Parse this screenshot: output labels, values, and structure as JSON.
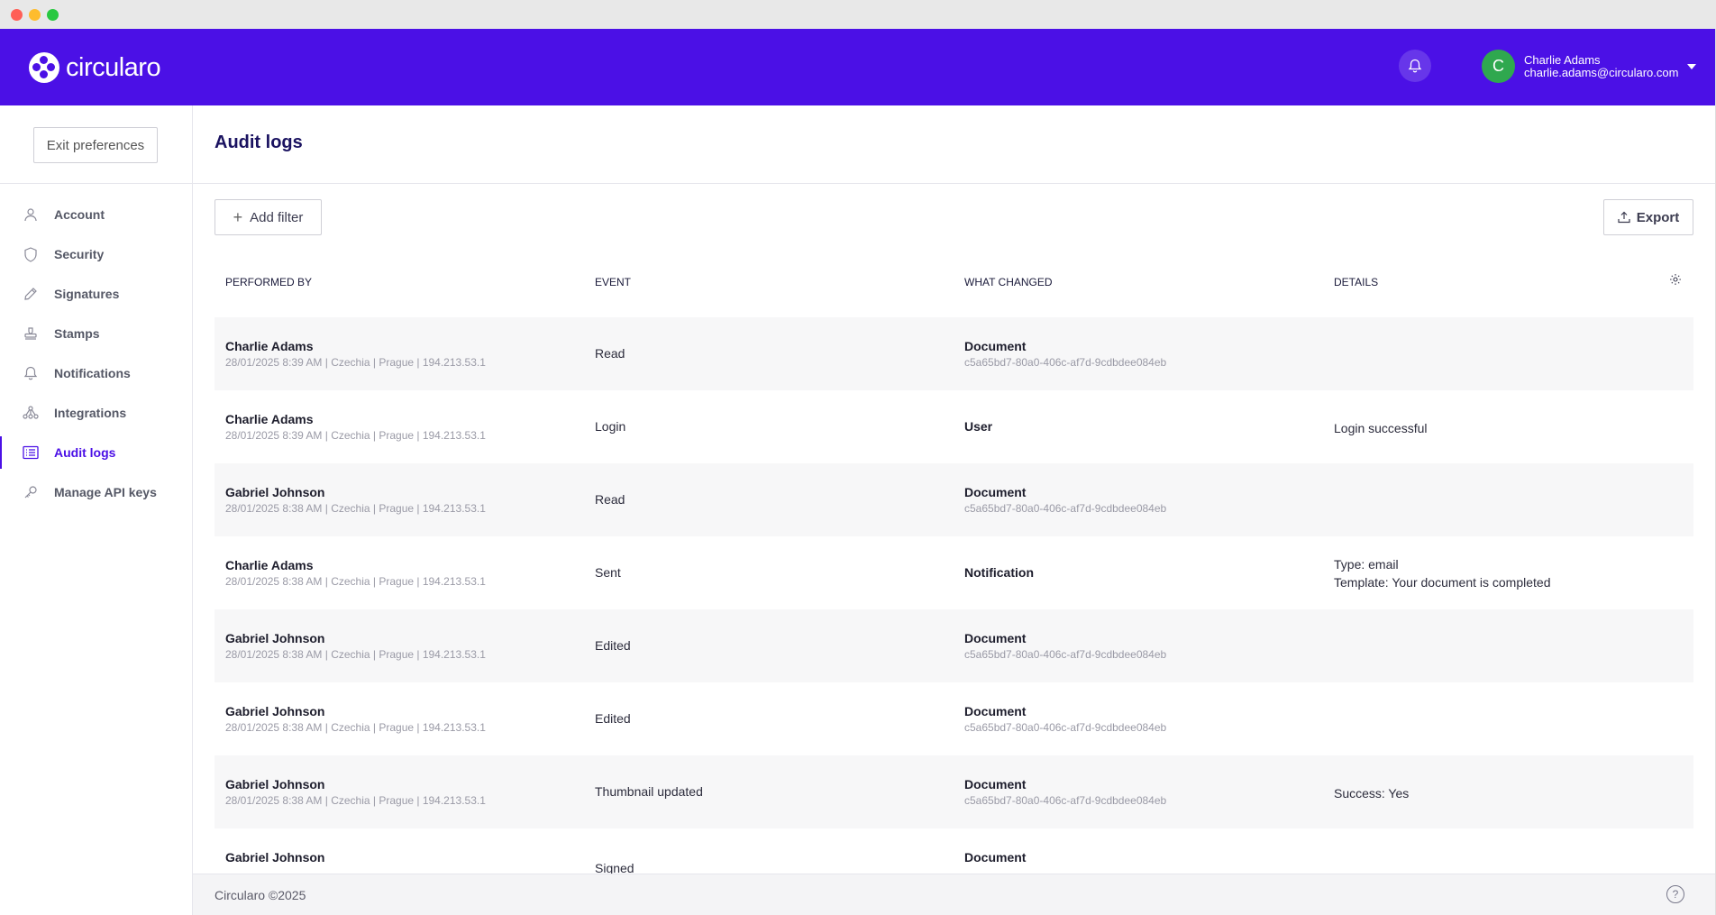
{
  "header": {
    "brand": "circularo",
    "user_initial": "C",
    "user_name": "Charlie Adams",
    "user_email": "charlie.adams@circularo.com",
    "brand_color": "#4b10e6",
    "avatar_color": "#2fa84f"
  },
  "sidebar": {
    "exit_label": "Exit preferences",
    "items": [
      {
        "label": "Account",
        "icon": "user-icon"
      },
      {
        "label": "Security",
        "icon": "shield-icon"
      },
      {
        "label": "Signatures",
        "icon": "pen-icon"
      },
      {
        "label": "Stamps",
        "icon": "stamp-icon"
      },
      {
        "label": "Notifications",
        "icon": "bell-icon"
      },
      {
        "label": "Integrations",
        "icon": "integrations-icon"
      },
      {
        "label": "Audit logs",
        "icon": "list-icon",
        "active": true
      },
      {
        "label": "Manage API keys",
        "icon": "key-icon"
      }
    ]
  },
  "main": {
    "title": "Audit logs",
    "add_filter_label": "Add filter",
    "export_label": "Export",
    "columns": [
      "PERFORMED BY",
      "EVENT",
      "WHAT CHANGED",
      "DETAILS"
    ],
    "rows": [
      {
        "name": "Charlie Adams",
        "meta": "28/01/2025 8:39 AM  |  Czechia  |  Prague  |  194.213.53.1",
        "event": "Read",
        "what": "Document",
        "what_id": "c5a65bd7-80a0-406c-af7d-9cdbdee084eb",
        "details": ""
      },
      {
        "name": "Charlie Adams",
        "meta": "28/01/2025 8:39 AM  |  Czechia  |  Prague  |  194.213.53.1",
        "event": "Login",
        "what": "User",
        "what_id": "",
        "details": "Login successful"
      },
      {
        "name": "Gabriel Johnson",
        "meta": "28/01/2025 8:38 AM  |  Czechia  |  Prague  |  194.213.53.1",
        "event": "Read",
        "what": "Document",
        "what_id": "c5a65bd7-80a0-406c-af7d-9cdbdee084eb",
        "details": ""
      },
      {
        "name": "Charlie Adams",
        "meta": "28/01/2025 8:38 AM  |  Czechia  |  Prague  |  194.213.53.1",
        "event": "Sent",
        "what": "Notification",
        "what_id": "",
        "details": "Type: email",
        "details2": "Template: Your document is completed"
      },
      {
        "name": "Gabriel Johnson",
        "meta": "28/01/2025 8:38 AM  |  Czechia  |  Prague  |  194.213.53.1",
        "event": "Edited",
        "what": "Document",
        "what_id": "c5a65bd7-80a0-406c-af7d-9cdbdee084eb",
        "details": ""
      },
      {
        "name": "Gabriel Johnson",
        "meta": "28/01/2025 8:38 AM  |  Czechia  |  Prague  |  194.213.53.1",
        "event": "Edited",
        "what": "Document",
        "what_id": "c5a65bd7-80a0-406c-af7d-9cdbdee084eb",
        "details": ""
      },
      {
        "name": "Gabriel Johnson",
        "meta": "28/01/2025 8:38 AM  |  Czechia  |  Prague  |  194.213.53.1",
        "event": "Thumbnail updated",
        "what": "Document",
        "what_id": "c5a65bd7-80a0-406c-af7d-9cdbdee084eb",
        "details": "Success: Yes"
      },
      {
        "name": "Gabriel Johnson",
        "meta": "",
        "event": "Signed",
        "what": "Document",
        "what_id": "",
        "details": ""
      }
    ]
  },
  "footer": {
    "copyright": "Circularo ©2025",
    "help_glyph": "?"
  }
}
